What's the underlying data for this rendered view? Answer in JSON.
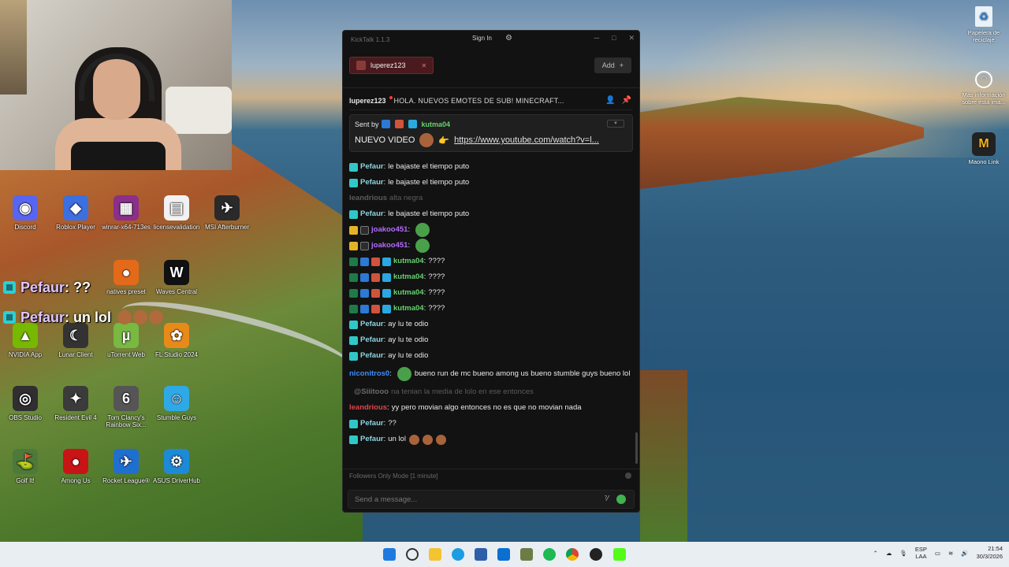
{
  "webcam": {
    "label": "webcam-overlay"
  },
  "overlay_chat": [
    {
      "name": "Pefaur",
      "text": ": ??"
    },
    {
      "name": "Pefaur",
      "text": " : un lol"
    }
  ],
  "desktop_icons": [
    {
      "label": "Discord",
      "color": "#5865F2",
      "glyph": "◉",
      "icon": "discord-icon"
    },
    {
      "label": "Roblox Player",
      "color": "#3c6fe0",
      "glyph": "◆",
      "icon": "roblox-icon"
    },
    {
      "label": "winrar-x64-713es",
      "color": "#8a2f8a",
      "glyph": "▦",
      "icon": "winrar-icon"
    },
    {
      "label": "licensevalidation",
      "color": "#f2f2f2",
      "glyph": "▤",
      "icon": "file-icon"
    },
    {
      "label": "MSI Afterburner",
      "color": "#2a2a2a",
      "glyph": "✈",
      "icon": "afterburner-icon"
    },
    {
      "label": "natives preset",
      "color": "#e36a1a",
      "glyph": "●",
      "icon": "fl-preset-icon"
    },
    {
      "label": "Waves Central",
      "color": "#111",
      "glyph": "W",
      "icon": "waves-icon"
    },
    {
      "label": "NVIDIA App",
      "color": "#76b900",
      "glyph": "▲",
      "icon": "nvidia-icon"
    },
    {
      "label": "Lunar Client",
      "color": "#333",
      "glyph": "☾",
      "icon": "lunar-icon"
    },
    {
      "label": "uTorrent Web",
      "color": "#79b842",
      "glyph": "µ",
      "icon": "utorrent-icon"
    },
    {
      "label": "FL Studio 2024",
      "color": "#e88a1a",
      "glyph": "✿",
      "icon": "flstudio-icon"
    },
    {
      "label": "OBS Studio",
      "color": "#302e31",
      "glyph": "◎",
      "icon": "obs-icon"
    },
    {
      "label": "Resident Evil 4",
      "color": "#3b3b3b",
      "glyph": "✦",
      "icon": "re4-icon"
    },
    {
      "label": "Tom Clancy's Rainbow Six...",
      "color": "#555",
      "glyph": "6",
      "icon": "r6-icon"
    },
    {
      "label": "Stumble Guys",
      "color": "#2fa9e6",
      "glyph": "☺",
      "icon": "stumble-icon"
    },
    {
      "label": "Golf It!",
      "color": "#4d7a3a",
      "glyph": "⛳",
      "icon": "golfit-icon"
    },
    {
      "label": "Among Us",
      "color": "#c81414",
      "glyph": "●",
      "icon": "amongus-icon"
    },
    {
      "label": "Rocket League®",
      "color": "#1f6fd1",
      "glyph": "✈",
      "icon": "rocketleague-icon"
    },
    {
      "label": "ASUS DriverHub",
      "color": "#1d8ad8",
      "glyph": "⚙",
      "icon": "asus-icon"
    }
  ],
  "right_icons": [
    {
      "label": "Papelera de reciclaje",
      "icon": "recycle-bin-icon"
    },
    {
      "label": "Más información sobre esta ima...",
      "icon": "info-camera-icon"
    },
    {
      "label": "Maono Link",
      "icon": "maono-icon"
    }
  ],
  "kicktalk": {
    "app_title": "KickTalk 1.1.3",
    "signin": "Sign In",
    "tab_label": "luperez123",
    "add_label": "Add",
    "channel": "luperez123",
    "stream_title": "HOLA. NUEVOS EMOTES DE SUB! MINECRAFT...",
    "pinned": {
      "sent_by": "Sent by",
      "user": "kutma04",
      "text": "NUEVO VIDEO",
      "link": "https://www.youtube.com/watch?v=l..."
    },
    "messages": [
      {
        "name": "Pefaur",
        "color": "#8fd3e0",
        "text": "le bajaste el tiempo puto",
        "badges": [
          "b-sub"
        ],
        "emotes": [],
        "faded": false
      },
      {
        "name": "Pefaur",
        "color": "#8fd3e0",
        "text": "le bajaste el tiempo puto",
        "badges": [
          "b-sub"
        ],
        "emotes": [],
        "faded": false
      },
      {
        "name": "leandrious",
        "color": "#5b5b5b",
        "text": "alta negra",
        "badges": [],
        "emotes": [],
        "faded": true
      },
      {
        "name": "Pefaur",
        "color": "#8fd3e0",
        "text": "le bajaste el tiempo puto",
        "badges": [
          "b-sub"
        ],
        "emotes": [],
        "faded": false
      },
      {
        "name": "joakoo451",
        "color": "#b46bff",
        "text": "",
        "badges": [
          "b-crown",
          "b-shades"
        ],
        "emotes": [
          "pepe"
        ],
        "faded": false
      },
      {
        "name": "joakoo451",
        "color": "#b46bff",
        "text": "",
        "badges": [
          "b-crown",
          "b-shades"
        ],
        "emotes": [
          "pepe"
        ],
        "faded": false
      },
      {
        "name": "kutma04",
        "color": "#66d36e",
        "text": "????",
        "badges": [
          "b-green",
          "b-blue",
          "b-red",
          "b-cube"
        ],
        "emotes": [],
        "faded": false
      },
      {
        "name": "kutma04",
        "color": "#66d36e",
        "text": "????",
        "badges": [
          "b-green",
          "b-blue",
          "b-red",
          "b-cube"
        ],
        "emotes": [],
        "faded": false
      },
      {
        "name": "kutma04",
        "color": "#66d36e",
        "text": "????",
        "badges": [
          "b-green",
          "b-blue",
          "b-red",
          "b-cube"
        ],
        "emotes": [],
        "faded": false
      },
      {
        "name": "kutma04",
        "color": "#66d36e",
        "text": "????",
        "badges": [
          "b-green",
          "b-blue",
          "b-red",
          "b-cube"
        ],
        "emotes": [],
        "faded": false
      },
      {
        "name": "Pefaur",
        "color": "#8fd3e0",
        "text": "ay lu te odio",
        "badges": [
          "b-sub"
        ],
        "emotes": [],
        "faded": false
      },
      {
        "name": "Pefaur",
        "color": "#8fd3e0",
        "text": "ay lu te odio",
        "badges": [
          "b-sub"
        ],
        "emotes": [],
        "faded": false
      },
      {
        "name": "Pefaur",
        "color": "#8fd3e0",
        "text": "ay lu te odio",
        "badges": [
          "b-sub"
        ],
        "emotes": [],
        "faded": false
      },
      {
        "name": "niconitros0",
        "color": "#3b8dff",
        "text": "bueno run de mc bueno among us bueno stumble guys bueno lol",
        "badges": [],
        "emotes": [
          "pepe-inline"
        ],
        "faded": false
      },
      {
        "name": "@Siiitooo",
        "color": "#6a6a6a",
        "text": "na tenian la media de lolo en ese entonces",
        "badges": [],
        "emotes": [],
        "faded": true,
        "reply": true
      },
      {
        "name": "leandrious",
        "color": "#e0454a",
        "text": "yy pero movian algo entonces no es que no movian nada",
        "badges": [],
        "emotes": [],
        "faded": false
      },
      {
        "name": "Pefaur",
        "color": "#8fd3e0",
        "text": "??",
        "badges": [
          "b-sub"
        ],
        "emotes": [],
        "faded": false
      },
      {
        "name": "Pefaur",
        "color": "#8fd3e0",
        "text": "un lol",
        "badges": [
          "b-sub"
        ],
        "emotes": [
          "face",
          "face",
          "face"
        ],
        "faded": false
      }
    ],
    "mode_text": "Followers Only Mode [1 minute]",
    "input_placeholder": "Send a message..."
  },
  "tray": {
    "lang1": "ESP",
    "lang2": "LAA",
    "time": "21:54",
    "date": "30/3/2026"
  }
}
